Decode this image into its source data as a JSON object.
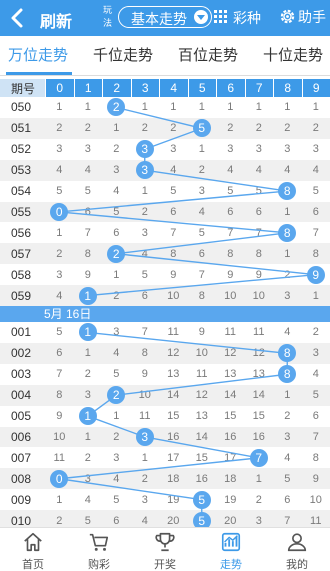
{
  "header": {
    "title": "刷新",
    "play_label": "玩法",
    "lottery_type": "基本走势",
    "caizhong_label": "彩种",
    "helper_label": "助手",
    "accent_color": "#3d9ae8"
  },
  "tabs": [
    {
      "label": "万位走势",
      "active": true
    },
    {
      "label": "千位走势",
      "active": false
    },
    {
      "label": "百位走势",
      "active": false
    },
    {
      "label": "十位走势",
      "active": false
    }
  ],
  "table": {
    "header": [
      "期号",
      "0",
      "1",
      "2",
      "3",
      "4",
      "5",
      "6",
      "7",
      "8",
      "9"
    ],
    "date_separator": "5月 16日",
    "groups": [
      {
        "rows": [
          {
            "issue": "050",
            "hit": 2,
            "cells": [
              1,
              1,
              2,
              1,
              1,
              1,
              1,
              1,
              1,
              1
            ]
          },
          {
            "issue": "051",
            "hit": 5,
            "cells": [
              2,
              2,
              1,
              2,
              2,
              5,
              2,
              2,
              2,
              2
            ]
          },
          {
            "issue": "052",
            "hit": 3,
            "cells": [
              3,
              3,
              2,
              3,
              3,
              1,
              3,
              3,
              3,
              3
            ]
          },
          {
            "issue": "053",
            "hit": 3,
            "cells": [
              4,
              4,
              3,
              3,
              4,
              2,
              4,
              4,
              4,
              4
            ]
          },
          {
            "issue": "054",
            "hit": 8,
            "cells": [
              5,
              5,
              4,
              1,
              5,
              3,
              5,
              5,
              8,
              5
            ]
          },
          {
            "issue": "055",
            "hit": 0,
            "cells": [
              0,
              6,
              5,
              2,
              6,
              4,
              6,
              6,
              1,
              6
            ]
          },
          {
            "issue": "056",
            "hit": 8,
            "cells": [
              1,
              7,
              6,
              3,
              7,
              5,
              7,
              7,
              8,
              7
            ]
          },
          {
            "issue": "057",
            "hit": 2,
            "cells": [
              2,
              8,
              2,
              4,
              8,
              6,
              8,
              8,
              1,
              8
            ]
          },
          {
            "issue": "058",
            "hit": 9,
            "cells": [
              3,
              9,
              1,
              5,
              9,
              7,
              9,
              9,
              2,
              9
            ]
          },
          {
            "issue": "059",
            "hit": 1,
            "cells": [
              4,
              1,
              2,
              6,
              10,
              8,
              10,
              10,
              3,
              1
            ]
          }
        ]
      },
      {
        "rows": [
          {
            "issue": "001",
            "hit": 1,
            "cells": [
              5,
              1,
              3,
              7,
              11,
              9,
              11,
              11,
              4,
              2
            ]
          },
          {
            "issue": "002",
            "hit": 8,
            "cells": [
              6,
              1,
              4,
              8,
              12,
              10,
              12,
              12,
              8,
              3
            ]
          },
          {
            "issue": "003",
            "hit": 8,
            "cells": [
              7,
              2,
              5,
              9,
              13,
              11,
              13,
              13,
              8,
              4
            ]
          },
          {
            "issue": "004",
            "hit": 2,
            "cells": [
              8,
              3,
              2,
              10,
              14,
              12,
              14,
              14,
              1,
              5
            ]
          },
          {
            "issue": "005",
            "hit": 1,
            "cells": [
              9,
              1,
              1,
              11,
              15,
              13,
              15,
              15,
              2,
              6
            ]
          },
          {
            "issue": "006",
            "hit": 3,
            "cells": [
              10,
              1,
              2,
              3,
              16,
              14,
              16,
              16,
              3,
              7
            ]
          },
          {
            "issue": "007",
            "hit": 7,
            "cells": [
              11,
              2,
              3,
              1,
              17,
              15,
              17,
              7,
              4,
              8
            ]
          },
          {
            "issue": "008",
            "hit": 0,
            "cells": [
              0,
              3,
              4,
              2,
              18,
              16,
              18,
              1,
              5,
              9
            ]
          },
          {
            "issue": "009",
            "hit": 5,
            "cells": [
              1,
              4,
              5,
              3,
              19,
              5,
              19,
              2,
              6,
              10
            ]
          },
          {
            "issue": "010",
            "hit": 5,
            "cells": [
              2,
              5,
              6,
              4,
              20,
              5,
              20,
              3,
              7,
              11
            ]
          }
        ]
      }
    ]
  },
  "bottom_nav": [
    {
      "label": "首页",
      "icon": "home-icon",
      "active": false
    },
    {
      "label": "购彩",
      "icon": "cart-icon",
      "active": false
    },
    {
      "label": "开奖",
      "icon": "trophy-icon",
      "active": false
    },
    {
      "label": "走势",
      "icon": "trend-chart-icon",
      "active": true
    },
    {
      "label": "我的",
      "icon": "user-icon",
      "active": false
    }
  ]
}
